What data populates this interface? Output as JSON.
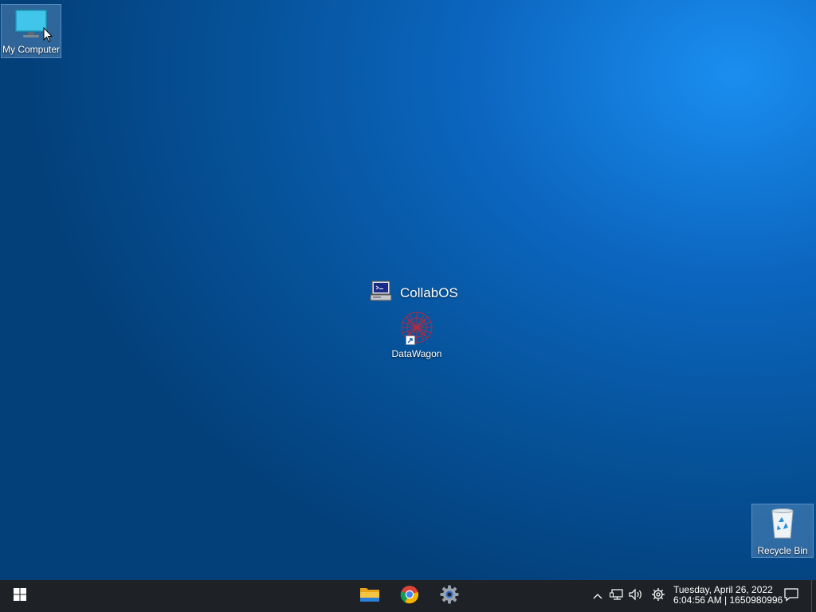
{
  "desktop": {
    "icons": {
      "my_computer": {
        "label": "My Computer",
        "icon": "monitor-icon"
      },
      "collabos": {
        "label": "CollabOS",
        "icon": "computer-terminal-icon"
      },
      "datawagon": {
        "label": "DataWagon",
        "icon": "datawagon-logo-icon"
      },
      "recycle_bin": {
        "label": "Recycle Bin",
        "icon": "recycle-bin-icon"
      }
    }
  },
  "taskbar": {
    "start_icon": "windows-logo-icon",
    "pinned": [
      {
        "name": "File Explorer",
        "icon": "folder-icon"
      },
      {
        "name": "Chrome",
        "icon": "chrome-icon"
      },
      {
        "name": "Settings",
        "icon": "settings-gear-icon"
      }
    ],
    "tray": {
      "icons": [
        "chevron-up-icon",
        "network-icon",
        "volume-icon",
        "gear-icon"
      ],
      "date": "Tuesday, April 26, 2022",
      "time": "6:04:56 AM | 1650980996"
    },
    "notification_icon": "notification-icon"
  },
  "colors": {
    "taskbar_bg": "#1e2226",
    "desktop_bg_light": "#1a8ef0",
    "desktop_bg_dark": "#033f79"
  }
}
